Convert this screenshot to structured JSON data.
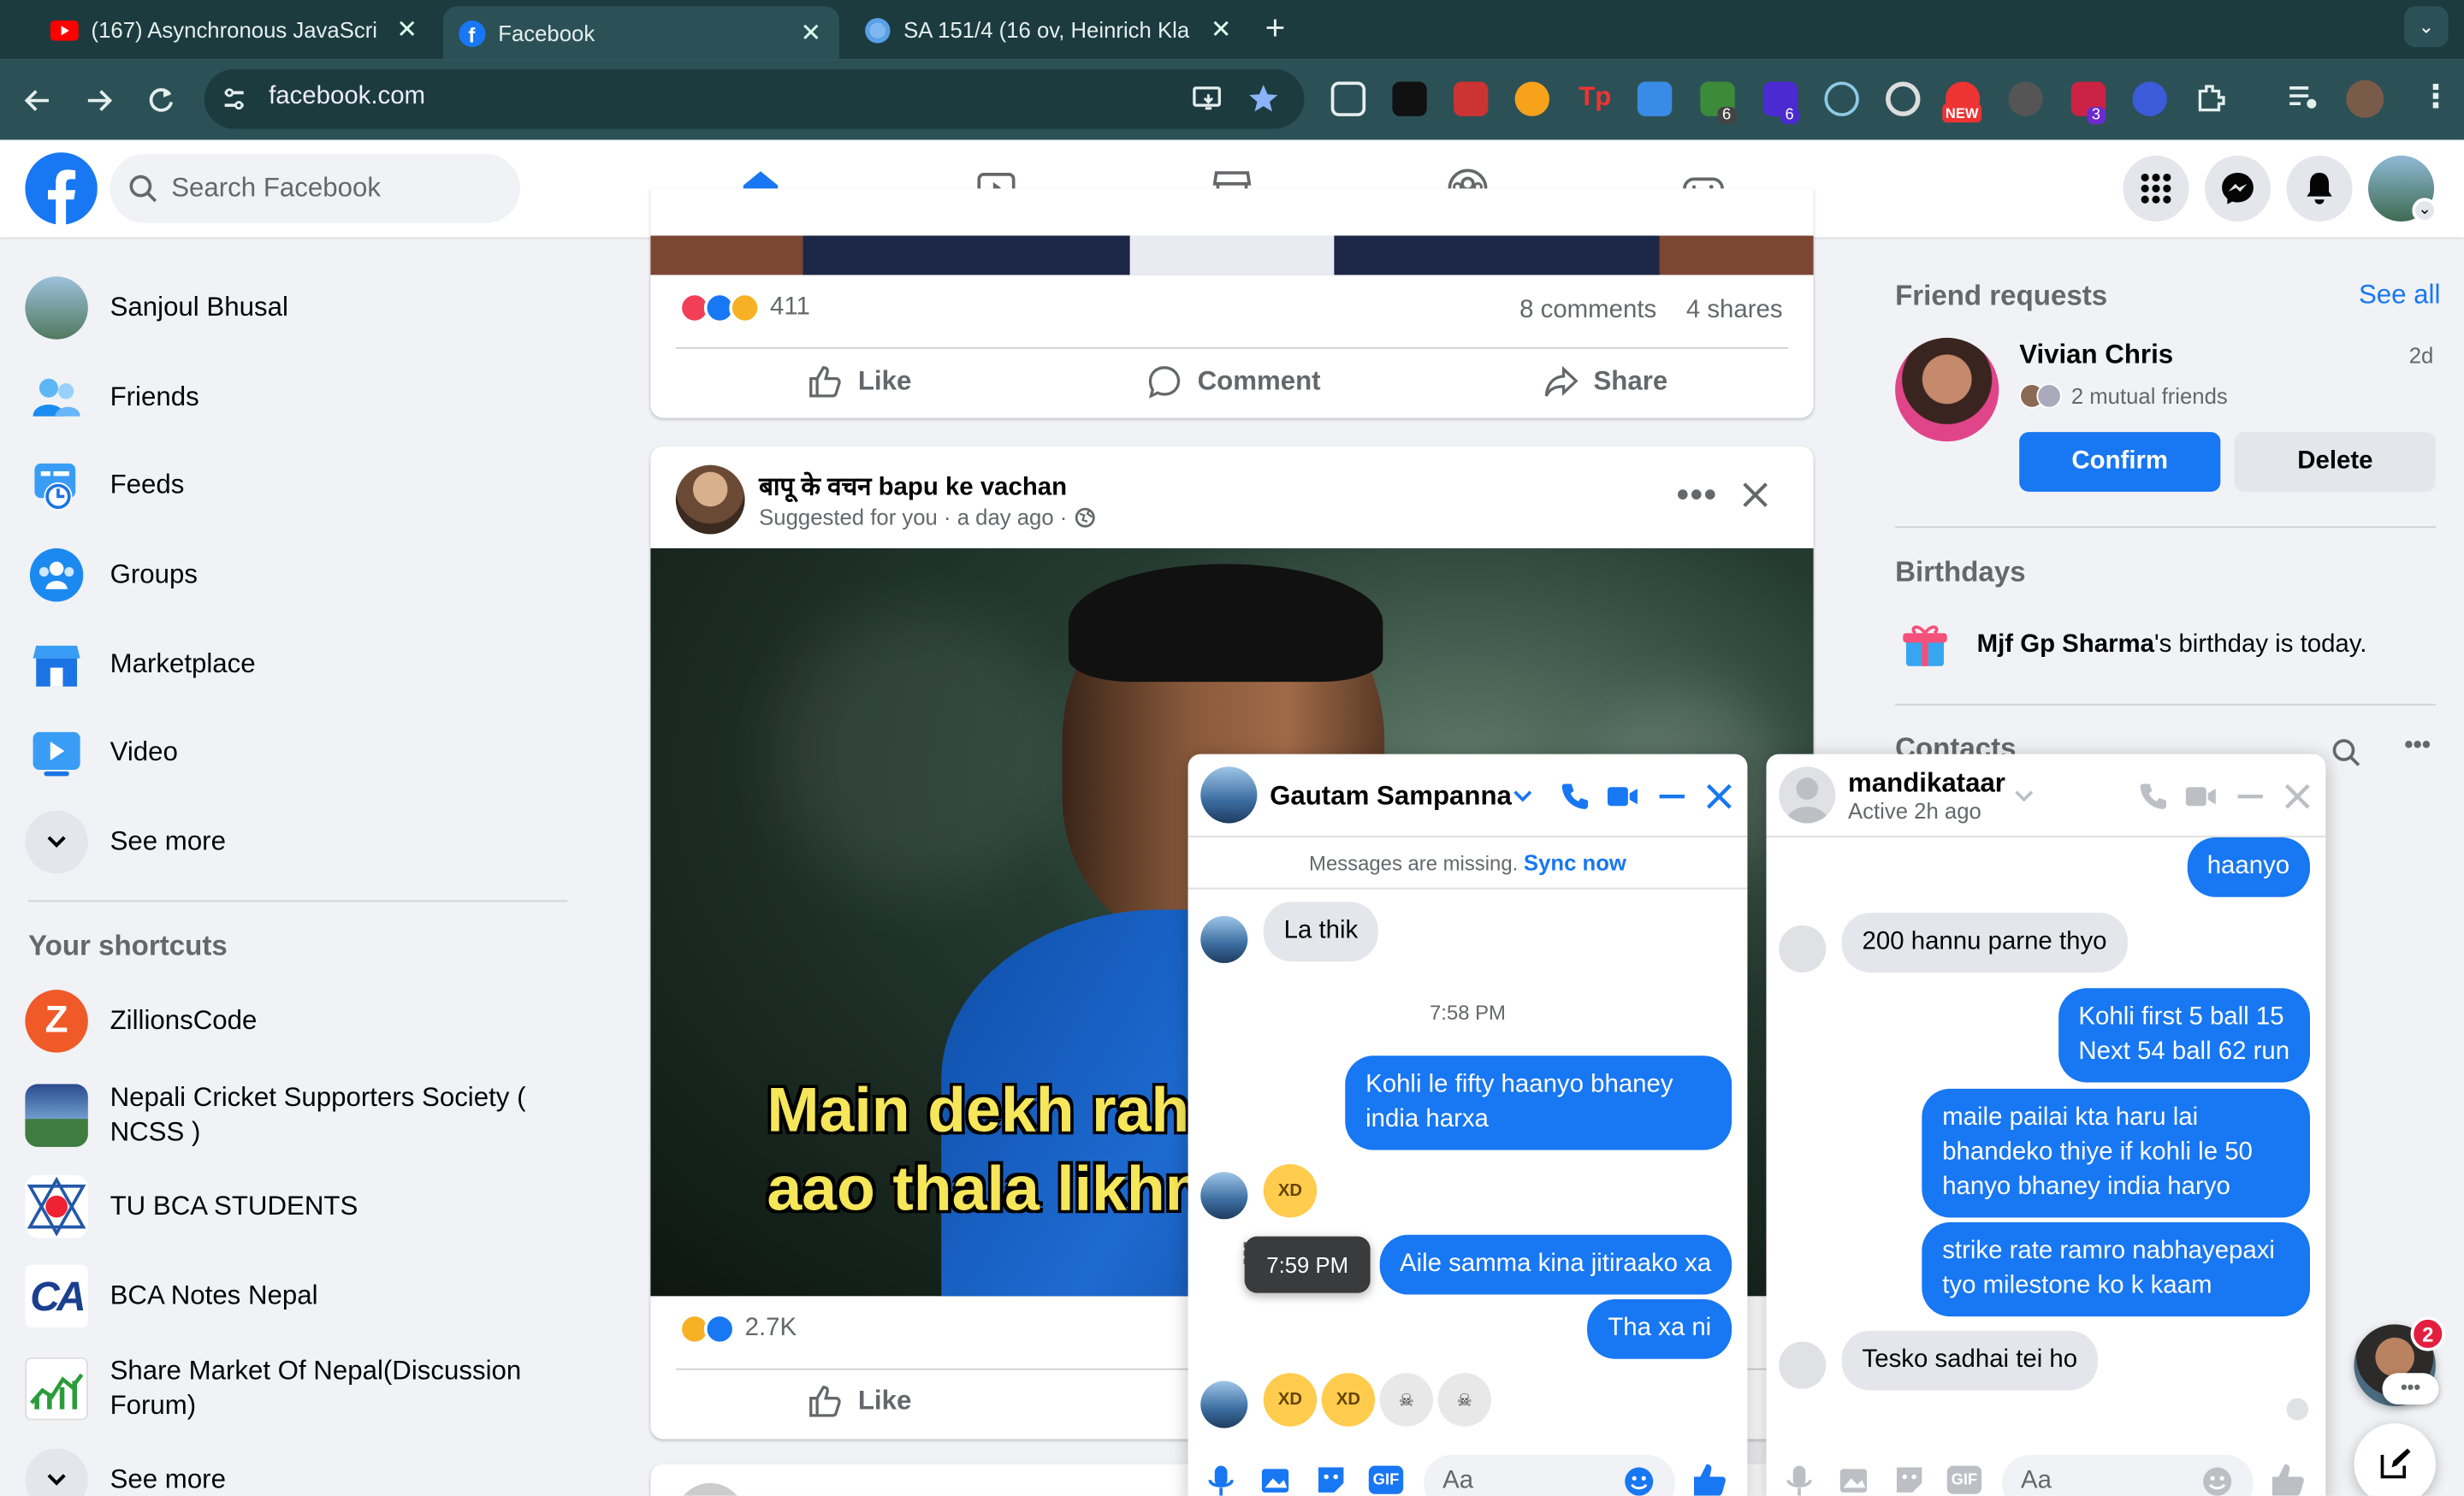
{
  "browser": {
    "tabs": [
      {
        "title": "(167) Asynchronous JavaScri"
      },
      {
        "title": "Facebook"
      },
      {
        "title": "SA 151/4 (16 ov, Heinrich Kla"
      }
    ],
    "url": "facebook.com",
    "ext_badges": {
      "b1": "6",
      "b2": "6",
      "new": "NEW",
      "b3": "3"
    }
  },
  "header": {
    "search_placeholder": "Search Facebook"
  },
  "sidebar": {
    "items": [
      {
        "label": "Sanjoul Bhusal",
        "icon": "avatar"
      },
      {
        "label": "Friends",
        "icon": "friends-icon"
      },
      {
        "label": "Feeds",
        "icon": "feeds-icon"
      },
      {
        "label": "Groups",
        "icon": "groups-icon"
      },
      {
        "label": "Marketplace",
        "icon": "marketplace-icon"
      },
      {
        "label": "Video",
        "icon": "video-icon"
      },
      {
        "label": "See more",
        "icon": "chevron-down-icon"
      }
    ],
    "shortcuts_title": "Your shortcuts",
    "shortcuts": [
      {
        "label": "ZillionsCode"
      },
      {
        "label": "Nepali Cricket Supporters Society ( NCSS )"
      },
      {
        "label": "TU BCA STUDENTS"
      },
      {
        "label": "BCA Notes Nepal"
      },
      {
        "label": "Share Market Of Nepal(Discussion Forum)"
      }
    ],
    "see_more2": "See more"
  },
  "post1": {
    "reactions": "411",
    "comments": "8 comments",
    "shares": "4 shares",
    "like": "Like",
    "comment": "Comment",
    "share": "Share"
  },
  "post2": {
    "author": "बापू के वचन bapu ke vachan",
    "meta": "Suggested for you · a day ago ·",
    "caption_line1": "Main dekh rah",
    "caption_line2": "aao thala likhn",
    "reactions": "2.7K",
    "like": "Like"
  },
  "right": {
    "friend_requests": "Friend requests",
    "see_all": "See all",
    "req_name": "Vivian Chris",
    "req_time": "2d",
    "mutual": "2 mutual friends",
    "confirm": "Confirm",
    "delete": "Delete",
    "birthdays": "Birthdays",
    "bday_name": "Mjf Gp Sharma",
    "bday_rest": "'s birthday is today.",
    "contacts": "Contacts"
  },
  "chat1": {
    "name": "Gautam Sampanna",
    "missing": "Messages are missing.",
    "sync": "Sync now",
    "msg_in1": "La thik",
    "time1": "7:58 PM",
    "msg_out1": "Kohli le fifty haanyo bhaney india harxa",
    "tooltip": "7:59 PM",
    "msg_out2": "Aile samma kina jitiraako xa",
    "msg_out3": "Tha xa ni",
    "input_placeholder": "Aa"
  },
  "chat2": {
    "name": "mandikataar",
    "status": "Active 2h ago",
    "msg_out1": "haanyo",
    "msg_in1": "200 hannu parne thyo",
    "msg_out2a": "Kohli first 5 ball 15",
    "msg_out2b": "Next 54 ball 62 run",
    "msg_out3": "maile pailai kta haru lai bhandeko thiye if kohli le 50 hanyo bhaney india haryo",
    "msg_out4": "strike rate ramro nabhayepaxi tyo milestone ko k kaam",
    "msg_in2": "Tesko sadhai tei ho",
    "input_placeholder": "Aa"
  },
  "floating": {
    "badge": "2"
  },
  "colors": {
    "fb_blue": "#1877f2",
    "tabbar": "#1c3b3f",
    "toolbar": "#2b5156",
    "bg": "#f0f2f5"
  }
}
